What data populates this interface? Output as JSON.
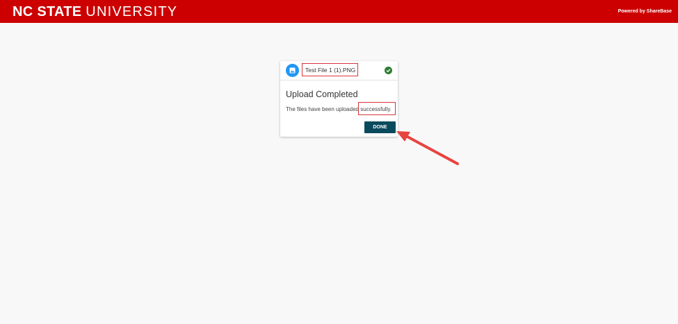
{
  "header": {
    "brand_bold": "NC STATE",
    "brand_thin": "UNIVERSITY",
    "powered_by": "Powered by ShareBase",
    "bg_color": "#cc0000"
  },
  "upload_card": {
    "file_icon": "image-file-icon",
    "file_name": "Test File 1 (1).PNG",
    "status_icon": "check-circle-icon",
    "title": "Upload Completed",
    "message": "The files have been uploaded successfully.",
    "done_label": "DONE",
    "done_color": "#0b4a5c"
  },
  "annotations": {
    "highlight_color": "#d9343b",
    "arrow_color": "#e8433e"
  }
}
